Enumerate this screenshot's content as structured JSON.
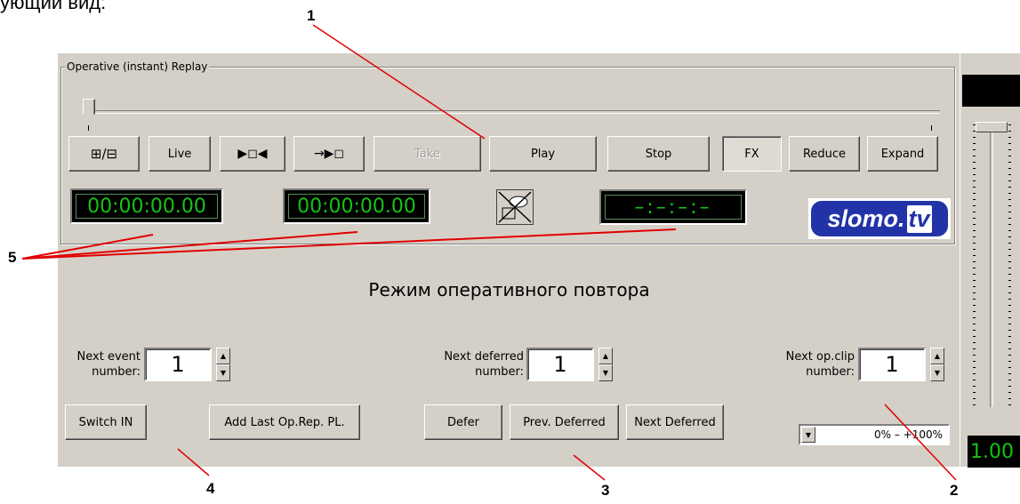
{
  "caption_fragment": "ующий вид:",
  "group": {
    "title": "Operative (instant) Replay"
  },
  "buttons": {
    "layout": "⊞/⊟",
    "live": "Live",
    "mark_in": "▶◻◀",
    "mark_out": "→▶◻",
    "take": "Take",
    "play": "Play",
    "stop": "Stop",
    "fx": "FX",
    "reduce": "Reduce",
    "expand": "Expand",
    "switch_in": "Switch IN",
    "add_last": "Add Last Op.Rep. PL.",
    "defer": "Defer",
    "prev_deferred": "Prev. Deferred",
    "next_deferred": "Next Deferred"
  },
  "timecodes": {
    "tc1": "00:00:00.00",
    "tc2": "00:00:00.00",
    "tc3": "–:–:–:–"
  },
  "mode_title": "Режим оперативного повтора",
  "next_event": {
    "label_line1": "Next event",
    "label_line2": "number:",
    "value": "1"
  },
  "next_deferred": {
    "label_line1": "Next deferred",
    "label_line2": "number:",
    "value": "1"
  },
  "next_opclip": {
    "label_line1": "Next op.clip",
    "label_line2": "number:",
    "value": "1"
  },
  "range_combo": {
    "value": "0%  –  +100%"
  },
  "logo": {
    "text_main": "slomo",
    "text_tv": "tv",
    "dot": "."
  },
  "right": {
    "value": "1.00"
  },
  "annotations": [
    "1",
    "2",
    "3",
    "4",
    "5"
  ],
  "colors": {
    "panel": "#d4d0c8",
    "timecode_green": "#16c316",
    "logo_blue": "#2233a8",
    "annotation_line": "#e00000"
  }
}
